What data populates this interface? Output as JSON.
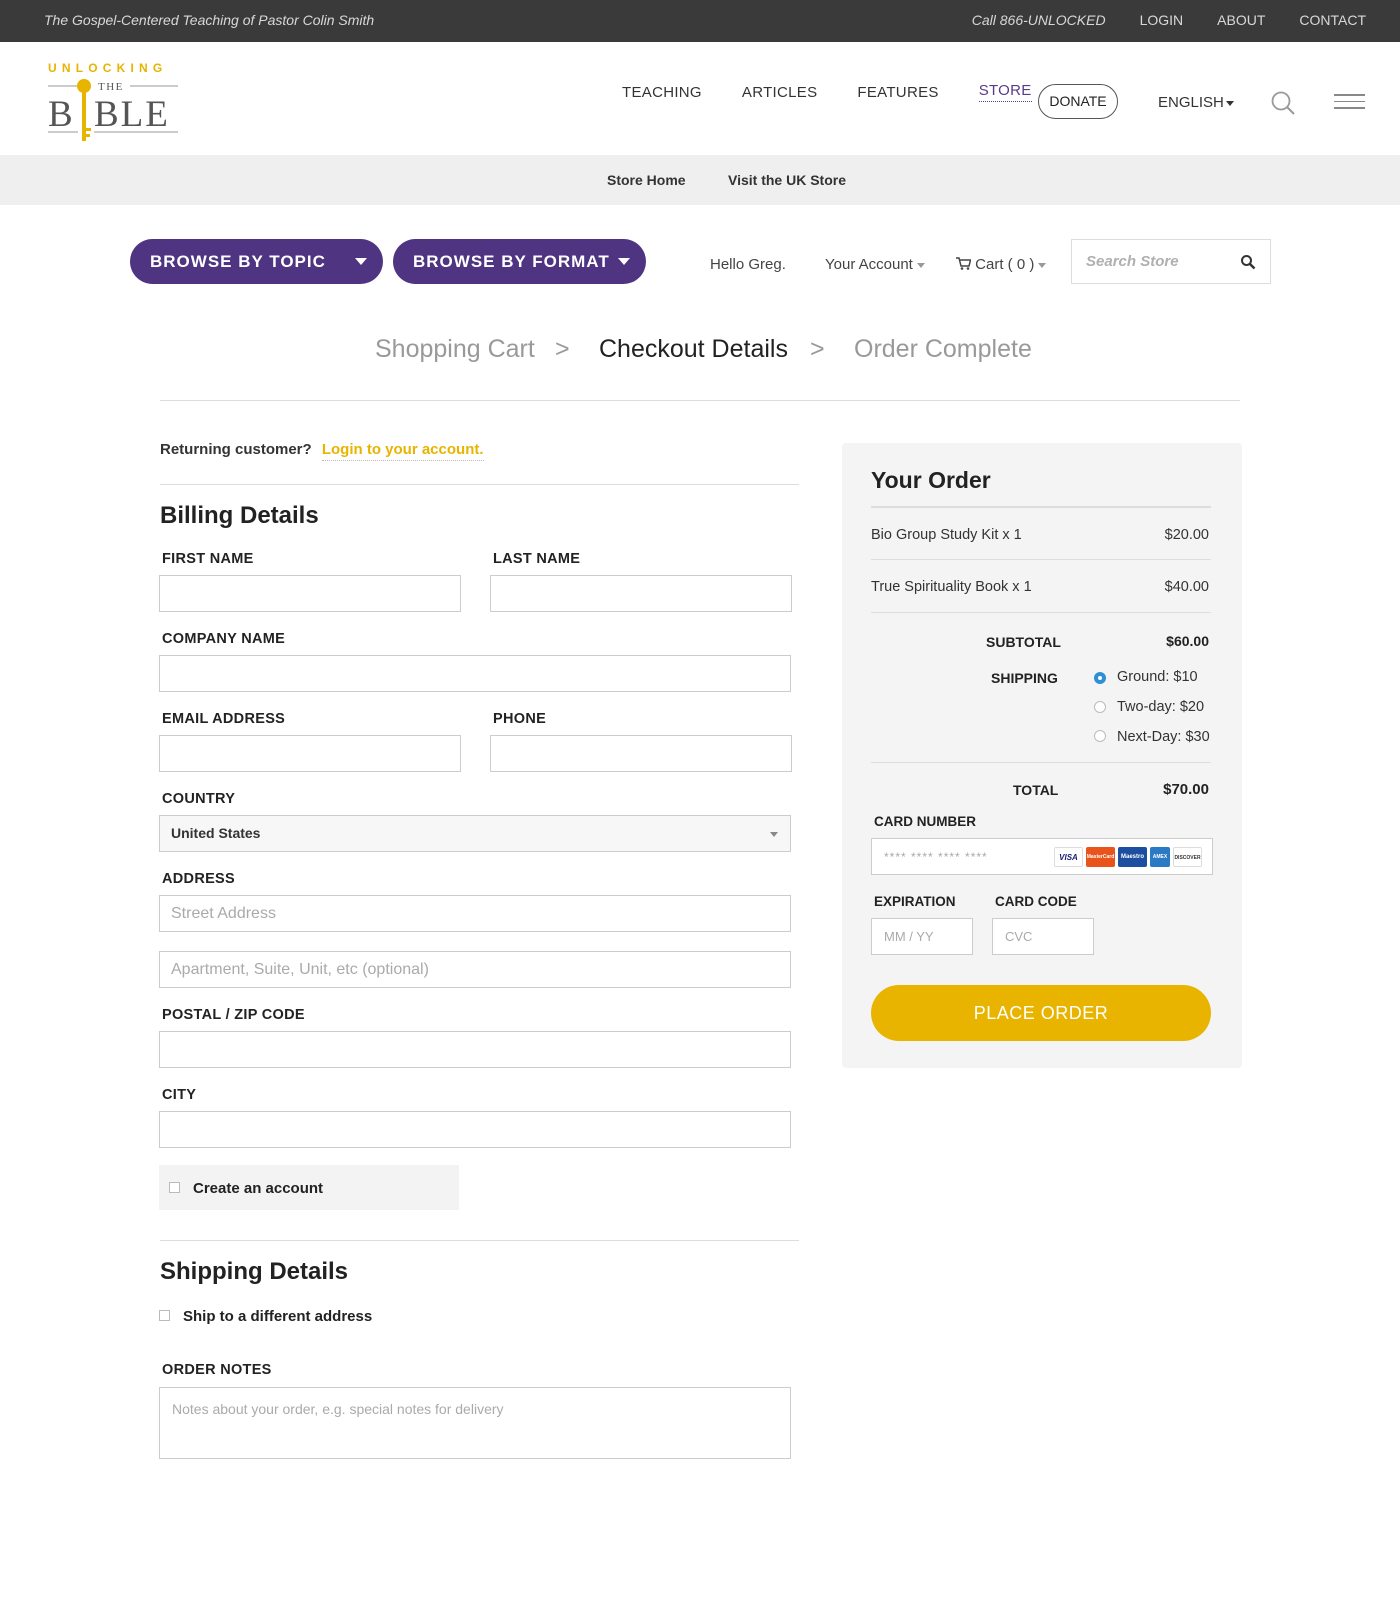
{
  "topbar": {
    "tagline": "The Gospel-Centered Teaching of Pastor Colin Smith",
    "call": "Call 866-UNLOCKED",
    "login": "LOGIN",
    "about": "ABOUT",
    "contact": "CONTACT"
  },
  "logo": {
    "line1": "UNLOCKING",
    "line2": "THE",
    "line3a": "B",
    "line3b": "BLE"
  },
  "nav": {
    "teaching": "TEACHING",
    "articles": "ARTICLES",
    "features": "FEATURES",
    "store": "STORE",
    "donate": "DONATE",
    "language": "ENGLISH"
  },
  "subnav": {
    "store_home": "Store Home",
    "uk_store": "Visit the UK Store"
  },
  "toolbar": {
    "browse_topic": "BROWSE BY TOPIC",
    "browse_format": "BROWSE BY FORMAT",
    "hello": "Hello Greg.",
    "account": "Your Account",
    "cart": "Cart ( 0 )",
    "search_placeholder": "Search Store"
  },
  "steps": {
    "cart": "Shopping Cart",
    "sep1": ">",
    "details": "Checkout Details",
    "sep2": ">",
    "complete": "Order Complete"
  },
  "returning": {
    "label": "Returning customer?",
    "link": "Login to your account."
  },
  "billing": {
    "title": "Billing Details",
    "first_name": "FIRST NAME",
    "last_name": "LAST NAME",
    "company": "COMPANY NAME",
    "email": "EMAIL ADDRESS",
    "phone": "PHONE",
    "country": "COUNTRY",
    "country_value": "United States",
    "address": "ADDRESS",
    "street_placeholder": "Street Address",
    "apt_placeholder": "Apartment, Suite, Unit, etc (optional)",
    "postal": "POSTAL / ZIP CODE",
    "city": "CITY",
    "create_account": "Create an account"
  },
  "shipping": {
    "title": "Shipping Details",
    "different_address": "Ship to a different address",
    "order_notes": "ORDER NOTES",
    "notes_placeholder": "Notes about your order, e.g. special notes for delivery"
  },
  "order": {
    "title": "Your Order",
    "items": [
      {
        "name": "Bio Group Study Kit  x 1",
        "price": "$20.00"
      },
      {
        "name": "True Spirituality Book  x 1",
        "price": "$40.00"
      }
    ],
    "subtotal_label": "SUBTOTAL",
    "subtotal": "$60.00",
    "shipping_label": "SHIPPING",
    "shipping_options": [
      {
        "label": "Ground: $10",
        "selected": true
      },
      {
        "label": "Two-day: $20",
        "selected": false
      },
      {
        "label": "Next-Day: $30",
        "selected": false
      }
    ],
    "total_label": "TOTAL",
    "total": "$70.00",
    "card_number_label": "CARD NUMBER",
    "card_placeholder": "**** **** **** ****",
    "card_brands": [
      "VISA",
      "MasterCard",
      "Maestro",
      "AMEX",
      "DISCOVER"
    ],
    "expiration_label": "EXPIRATION",
    "expiration_placeholder": "MM / YY",
    "card_code_label": "CARD CODE",
    "card_code_placeholder": "CVC",
    "place_order": "PLACE ORDER"
  },
  "colors": {
    "purple": "#4e3481",
    "gold": "#e8b400",
    "radio_blue": "#2d8fd5"
  }
}
